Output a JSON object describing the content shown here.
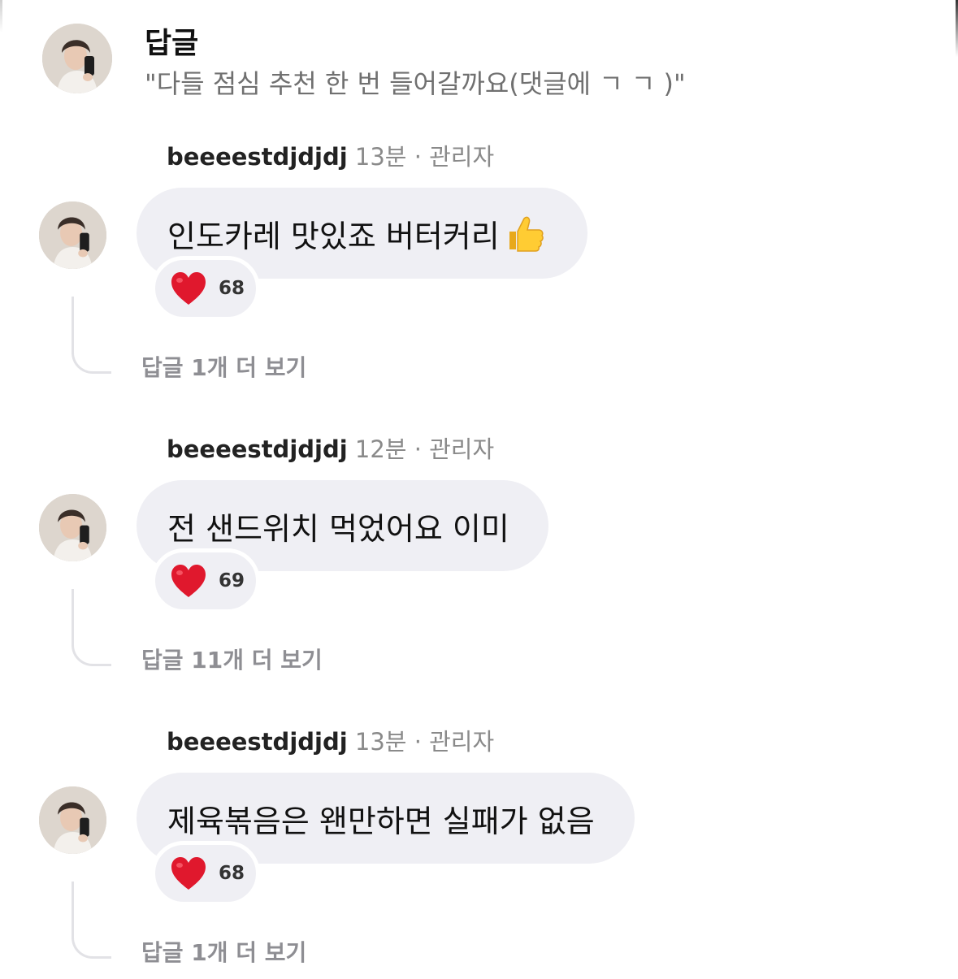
{
  "header": {
    "title": "답글",
    "subtitle": "\"다들 점심 추천 한 번 들어갈까요(댓글에 ㄱ ㄱ )\""
  },
  "comments": [
    {
      "username": "beeeestdjdjdj",
      "time": "13분",
      "separator": "·",
      "role": "관리자",
      "text": "인도카레 맛있죠 버터커리",
      "emoji": "thumbs-up-icon",
      "reaction_count": "68",
      "more_replies": "답글 1개 더 보기"
    },
    {
      "username": "beeeestdjdjdj",
      "time": "12분",
      "separator": "·",
      "role": "관리자",
      "text": "전 샌드위치 먹었어요 이미",
      "reaction_count": "69",
      "more_replies": "답글 11개 더 보기"
    },
    {
      "username": "beeeestdjdjdj",
      "time": "13분",
      "separator": "·",
      "role": "관리자",
      "text": "제육볶음은 왠만하면 실패가 없음",
      "reaction_count": "68",
      "more_replies": "답글 1개 더 보기"
    }
  ],
  "colors": {
    "bubble": "#efeff4",
    "heart": "#e0182d",
    "muted_text": "#8e8e93"
  }
}
